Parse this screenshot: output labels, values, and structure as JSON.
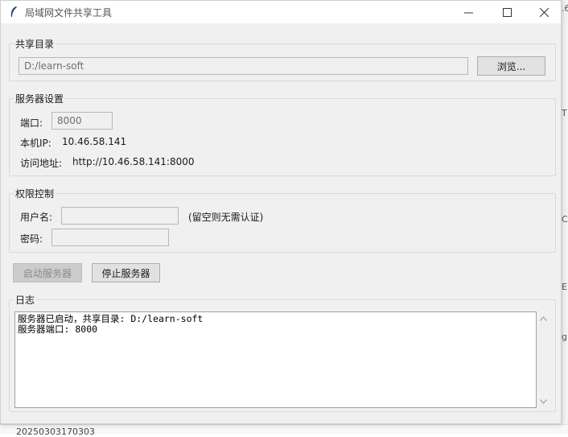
{
  "window": {
    "title": "局域网文件共享工具",
    "controls": {
      "minimize": "—",
      "maximize": "☐",
      "close": "✕"
    }
  },
  "share_dir": {
    "group_label": "共享目录",
    "path_value": "D:/learn-soft",
    "browse_label": "浏览..."
  },
  "server_settings": {
    "group_label": "服务器设置",
    "port_label": "端口:",
    "port_value": "8000",
    "ip_label": "本机IP:",
    "ip_value": "10.46.58.141",
    "url_label": "访问地址:",
    "url_value": "http://10.46.58.141:8000"
  },
  "permissions": {
    "group_label": "权限控制",
    "username_label": "用户名:",
    "username_value": "",
    "username_hint": "(留空则无需认证)",
    "password_label": "密码:",
    "password_value": ""
  },
  "actions": {
    "start_label": "启动服务器",
    "stop_label": "停止服务器"
  },
  "log": {
    "group_label": "日志",
    "lines": [
      "服务器已启动，共享目录: D:/learn-soft",
      "服务器端口: 8000"
    ]
  },
  "background": {
    "bottom_peek": "20250303170303"
  }
}
